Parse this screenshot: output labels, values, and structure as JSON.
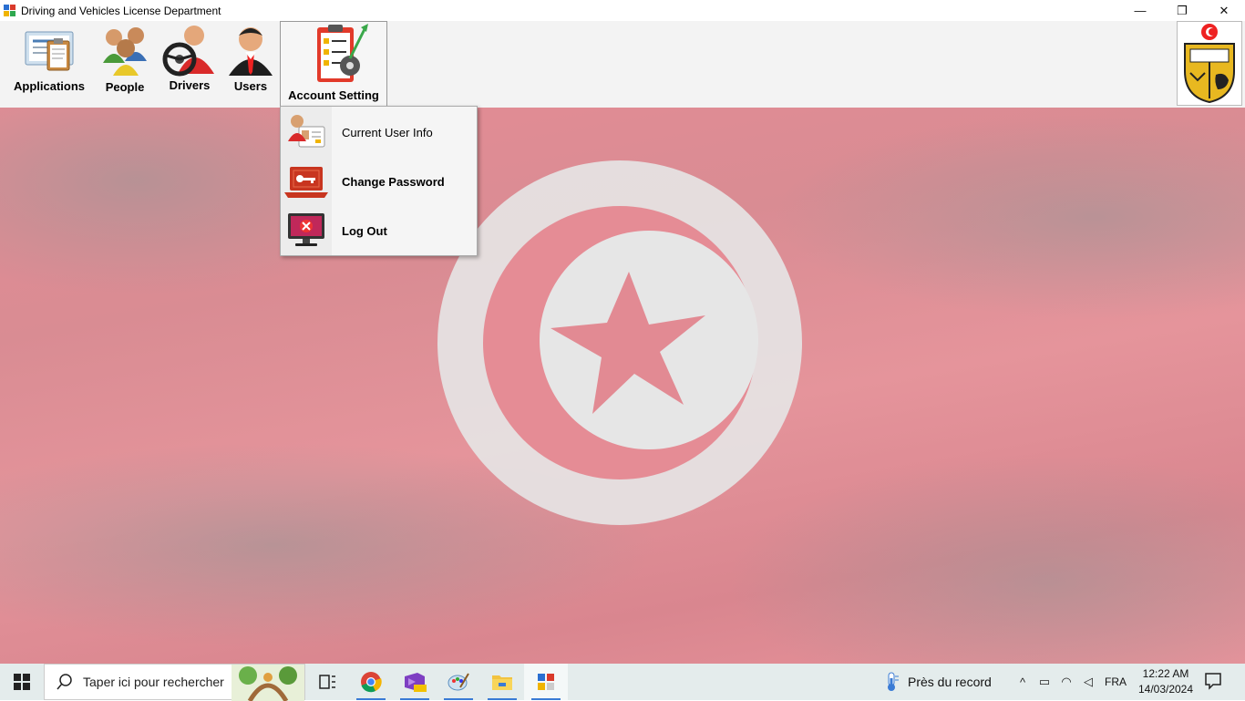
{
  "window": {
    "title": "Driving and Vehicles License Department",
    "minimize_glyph": "—",
    "restore_glyph": "❐",
    "close_glyph": "✕"
  },
  "menu": {
    "items": [
      {
        "label": "Applications",
        "icon": "applications-clipboard-icon"
      },
      {
        "label": "People",
        "icon": "people-group-icon"
      },
      {
        "label": "Drivers",
        "icon": "driver-steering-icon"
      },
      {
        "label": "Users",
        "icon": "user-businessman-icon"
      },
      {
        "label": "Account Setting",
        "icon": "account-setting-checklist-icon"
      }
    ],
    "emblem": "tunisia-coat-of-arms-icon"
  },
  "dropdown": {
    "items": [
      {
        "label": "Current User Info",
        "icon": "user-id-card-icon"
      },
      {
        "label": "Change Password",
        "icon": "laptop-key-icon"
      },
      {
        "label": "Log Out",
        "icon": "monitor-close-icon"
      }
    ]
  },
  "background": "tunisian-flag-waving",
  "taskbar": {
    "search_placeholder": "Taper ici pour rechercher",
    "weather_text": "Près du record",
    "language": "FRA",
    "time": "12:22 AM",
    "date": "14/03/2024",
    "accent": "#3a7bd5"
  },
  "colors": {
    "flag_red": "#e58c95",
    "menu_bg": "#f3f3f3",
    "taskbar_bg": "#e4ecec"
  }
}
